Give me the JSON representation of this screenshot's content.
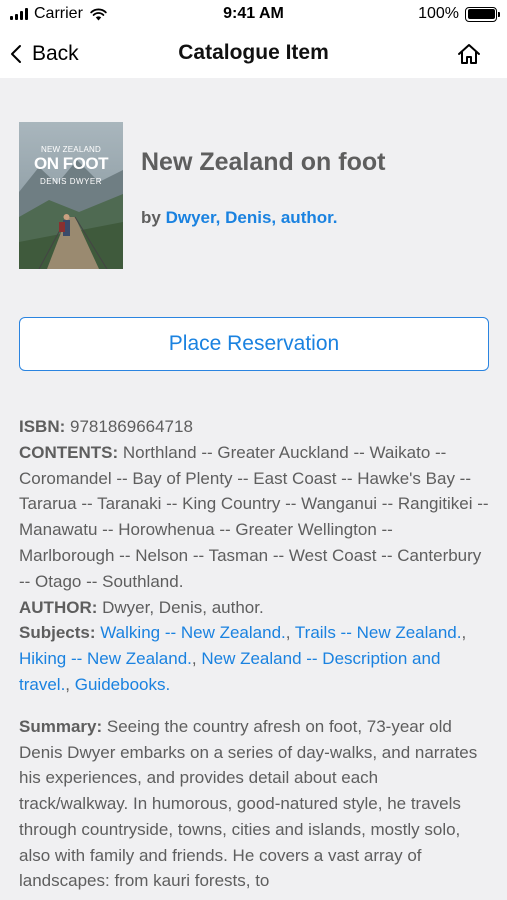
{
  "status_bar": {
    "carrier": "Carrier",
    "time": "9:41 AM",
    "battery": "100%",
    "battery_level": 1.0
  },
  "nav": {
    "back_label": "Back",
    "title": "Catalogue Item",
    "home_icon": "home-icon"
  },
  "book": {
    "title": "New Zealand on foot",
    "by_prefix": "by",
    "author_link": "Dwyer, Denis, author.",
    "cover": {
      "top_text": "NEW ZEALAND",
      "title_text": "ON FOOT",
      "author_text": "DENIS DWYER"
    }
  },
  "actions": {
    "reserve_label": "Place Reservation"
  },
  "details": {
    "isbn_label": "ISBN:",
    "isbn": "9781869664718",
    "contents_label": "CONTENTS:",
    "contents": "Northland -- Greater Auckland -- Waikato -- Coromandel -- Bay of Plenty -- East Coast -- Hawke's Bay -- Tararua -- Taranaki -- King Country -- Wanganui -- Rangitikei -- Manawatu -- Horowhenua -- Greater Wellington -- Marlborough -- Nelson -- Tasman -- West Coast -- Canterbury -- Otago -- Southland.",
    "author_label": "AUTHOR:",
    "author": "Dwyer, Denis, author.",
    "subjects_label": "Subjects:",
    "subjects": [
      "Walking -- New Zealand.",
      "Trails -- New Zealand.",
      "Hiking -- New Zealand.",
      "New Zealand -- Description and travel.",
      "Guidebooks."
    ],
    "subject_separator": ", "
  },
  "summary": {
    "label": "Summary:",
    "text": "Seeing the country afresh on foot, 73-year old Denis Dwyer embarks on a series of day-walks, and narrates his experiences, and provides detail about each track/walkway. In humorous, good-natured style, he travels through countryside, towns, cities and islands, mostly solo, also with family and friends. He covers a vast array of landscapes: from kauri forests, to"
  },
  "colors": {
    "link": "#1a82e0",
    "text": "#5e5e5e",
    "background": "#f0f0f2"
  }
}
